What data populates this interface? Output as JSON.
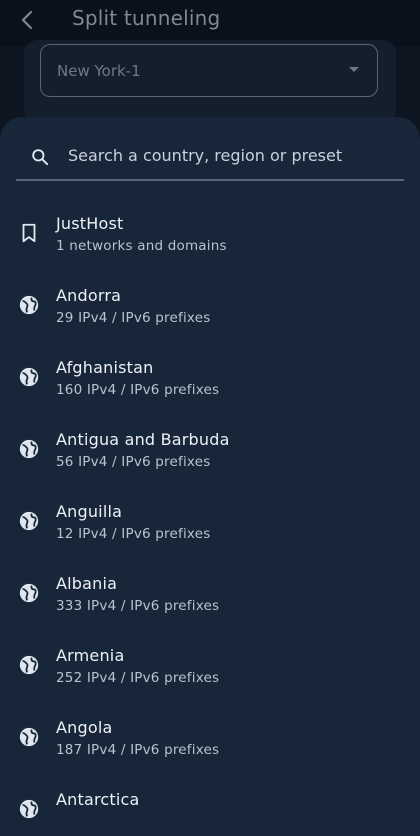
{
  "header": {
    "title": "Split tunneling",
    "back_icon": "back-arrow-icon"
  },
  "server_select": {
    "value": "New York-1"
  },
  "search": {
    "placeholder": "Search a country, region or preset",
    "value": ""
  },
  "items": [
    {
      "icon": "bookmark-icon",
      "title": "JustHost",
      "subtitle": "1 networks and domains"
    },
    {
      "icon": "globe-icon",
      "title": "Andorra",
      "subtitle": "29 IPv4 / IPv6 prefixes"
    },
    {
      "icon": "globe-icon",
      "title": "Afghanistan",
      "subtitle": "160 IPv4 / IPv6 prefixes"
    },
    {
      "icon": "globe-icon",
      "title": "Antigua and Barbuda",
      "subtitle": "56 IPv4 / IPv6 prefixes"
    },
    {
      "icon": "globe-icon",
      "title": "Anguilla",
      "subtitle": "12 IPv4 / IPv6 prefixes"
    },
    {
      "icon": "globe-icon",
      "title": "Albania",
      "subtitle": "333 IPv4 / IPv6 prefixes"
    },
    {
      "icon": "globe-icon",
      "title": "Armenia",
      "subtitle": "252 IPv4 / IPv6 prefixes"
    },
    {
      "icon": "globe-icon",
      "title": "Angola",
      "subtitle": "187 IPv4 / IPv6 prefixes"
    },
    {
      "icon": "globe-icon",
      "title": "Antarctica",
      "subtitle": ""
    }
  ],
  "colors": {
    "sheet": "#172639",
    "background": "#0b1320",
    "text": "#eef2f6",
    "subtext": "#b9c3ce"
  }
}
